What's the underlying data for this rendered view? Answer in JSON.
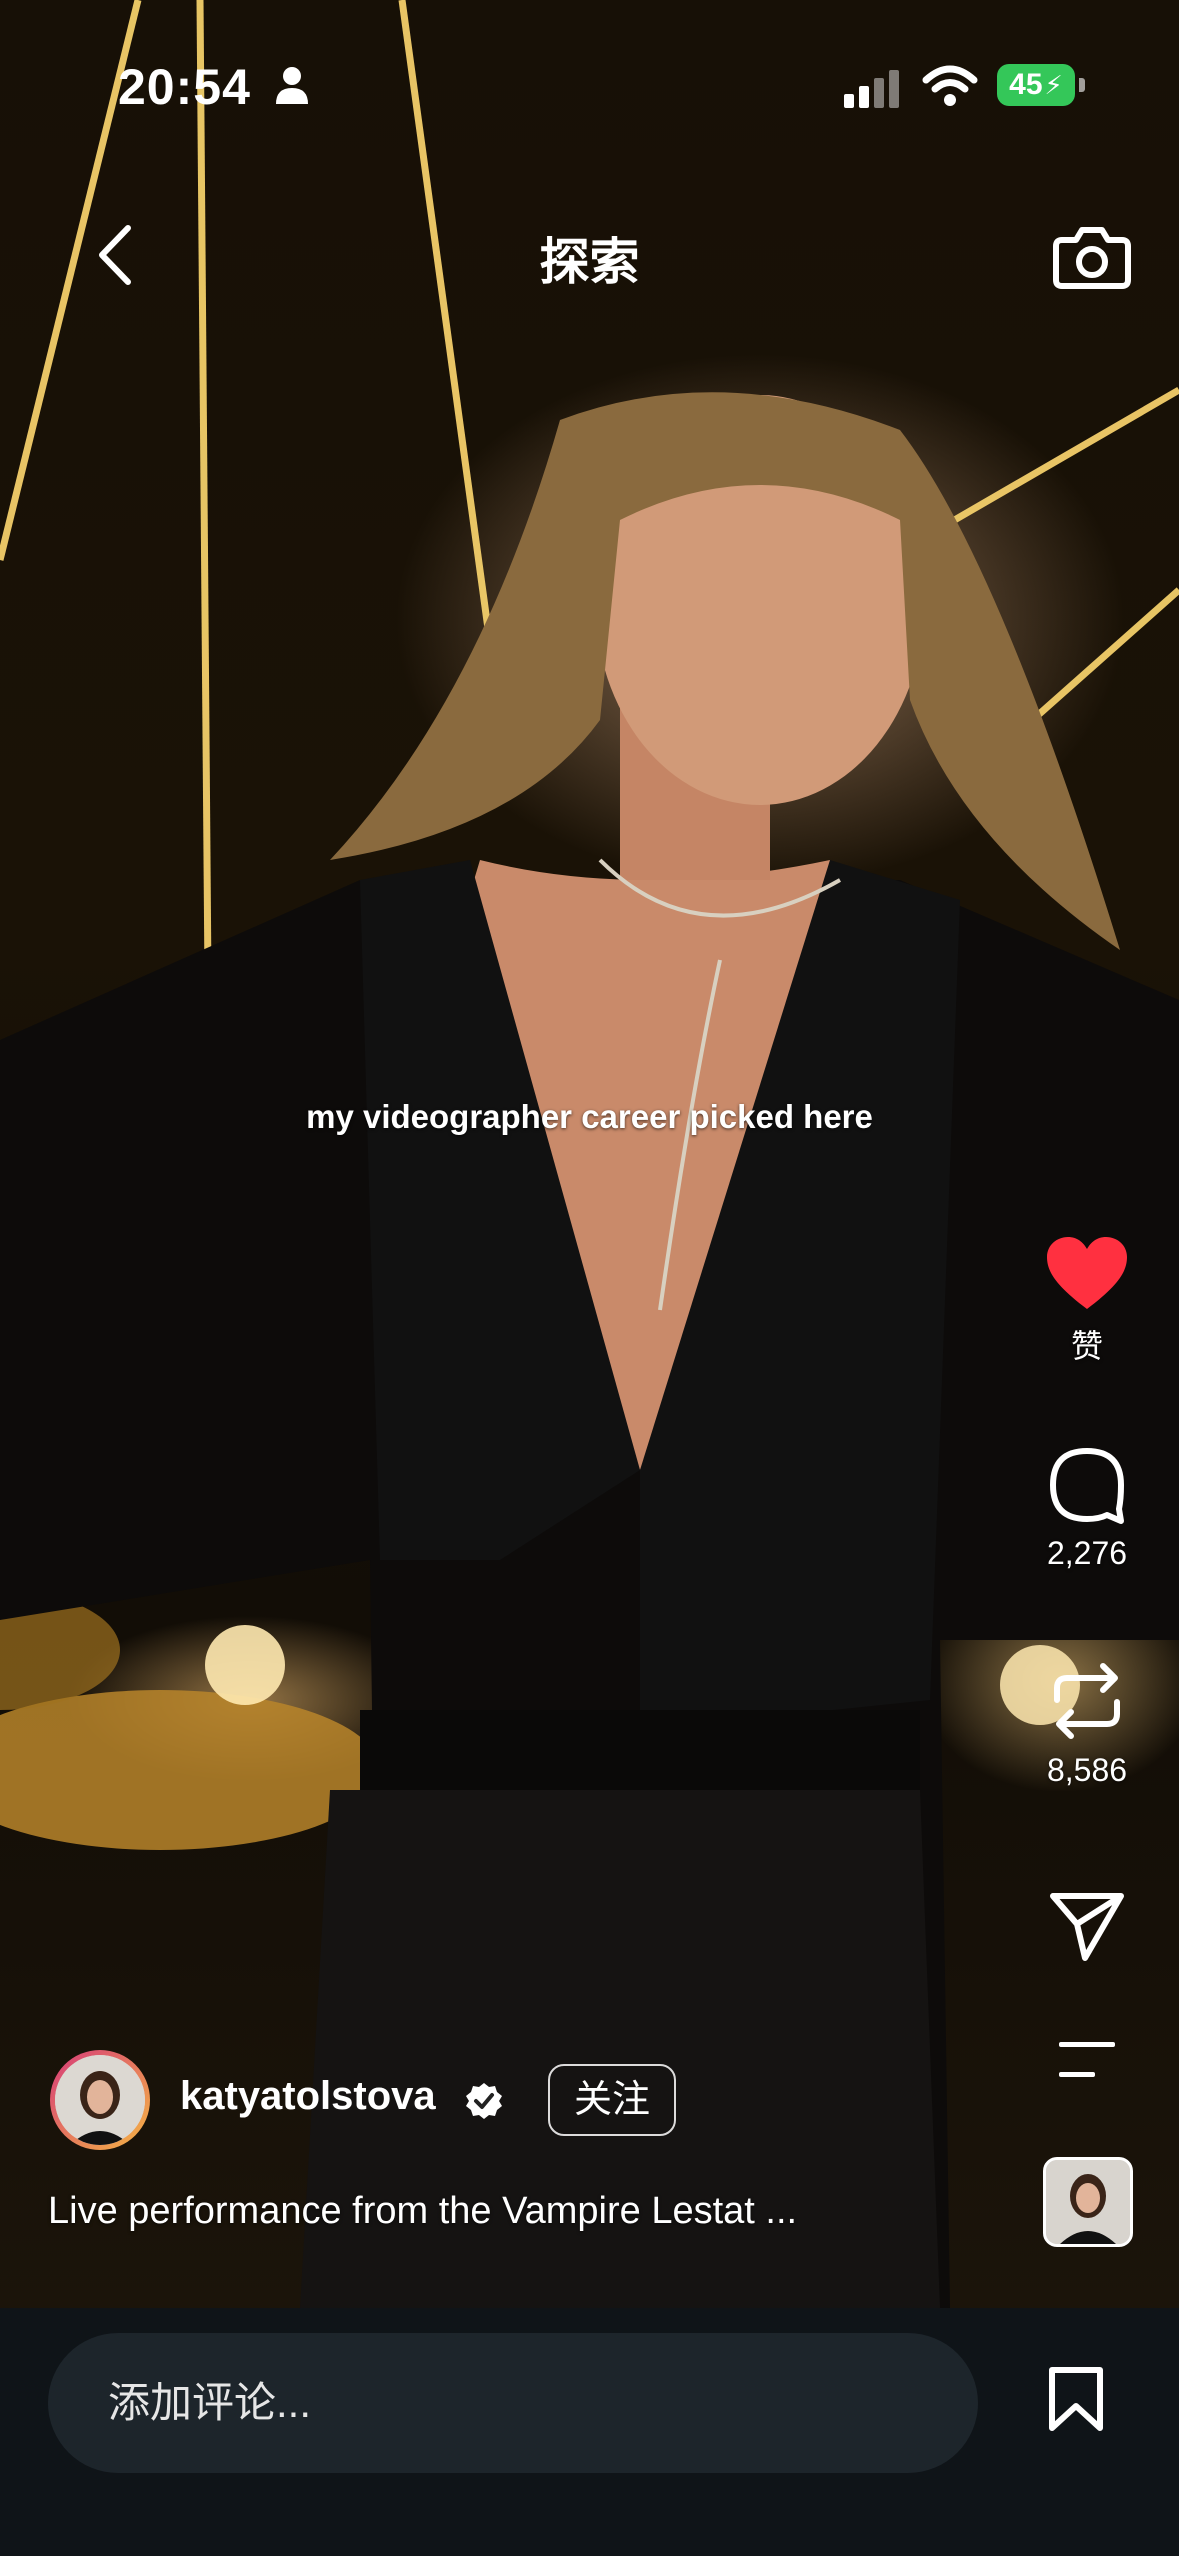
{
  "status_bar": {
    "time": "20:54",
    "battery": "45"
  },
  "header": {
    "title": "探索"
  },
  "video": {
    "overlay_text": "my videographer career picked here"
  },
  "actions": {
    "like": {
      "label": "赞",
      "color": "#ff3040"
    },
    "comment": {
      "count": "2,276"
    },
    "repost": {
      "count": "8,586"
    }
  },
  "author": {
    "username": "katyatolstova",
    "follow_label": "关注"
  },
  "caption": "Live performance from the Vampire Lestat ...",
  "comment_box": {
    "placeholder": "添加评论..."
  },
  "icons": [
    "person-icon",
    "signal-icon",
    "wifi-icon",
    "back-icon",
    "camera-icon",
    "heart-icon",
    "comment-icon",
    "repost-icon",
    "share-icon",
    "more-icon",
    "verified-icon",
    "bookmark-icon"
  ]
}
